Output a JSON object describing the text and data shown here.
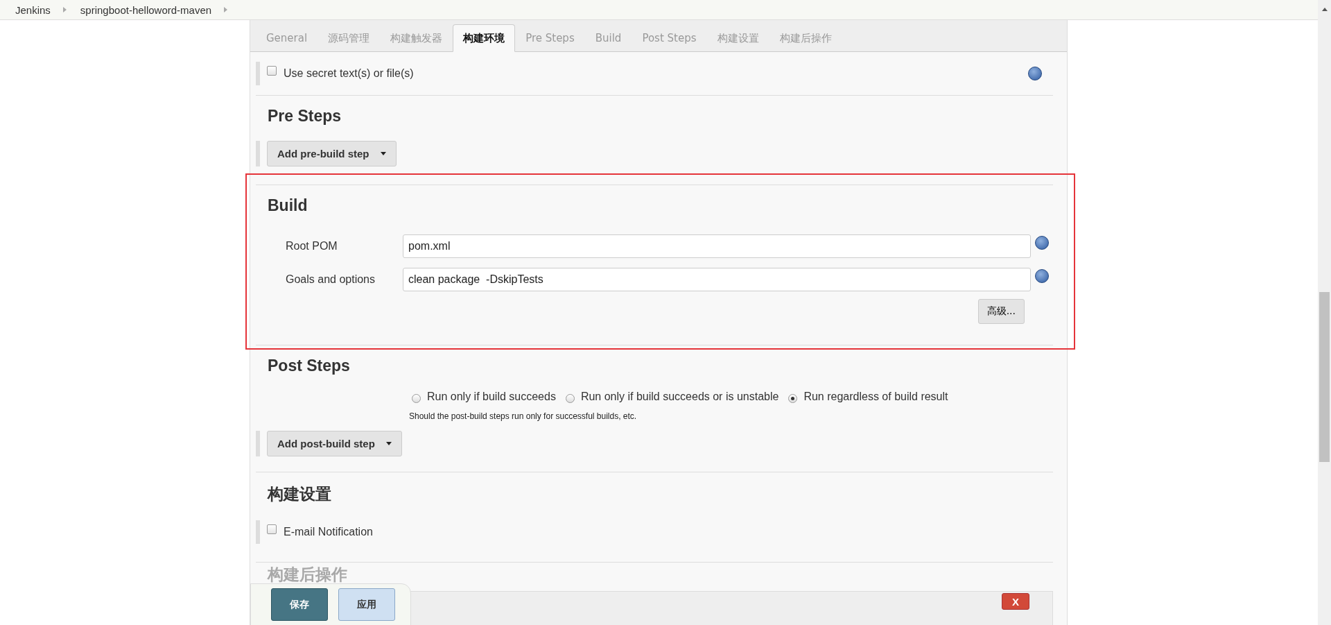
{
  "breadcrumbs": [
    "Jenkins",
    "springboot-helloword-maven"
  ],
  "tabs": [
    {
      "label": "General",
      "selected": false
    },
    {
      "label": "源码管理",
      "selected": false
    },
    {
      "label": "构建触发器",
      "selected": false
    },
    {
      "label": "构建环境",
      "selected": true
    },
    {
      "label": "Pre Steps",
      "selected": false
    },
    {
      "label": "Build",
      "selected": false
    },
    {
      "label": "Post Steps",
      "selected": false
    },
    {
      "label": "构建设置",
      "selected": false
    },
    {
      "label": "构建后操作",
      "selected": false
    }
  ],
  "build_environment": {
    "option": {
      "label": "Use secret text(s) or file(s)",
      "checked": false
    }
  },
  "pre_steps": {
    "title": "Pre Steps",
    "add_button": "Add pre-build step"
  },
  "build": {
    "title": "Build",
    "fields": [
      {
        "label": "Root POM",
        "value": "pom.xml"
      },
      {
        "label": "Goals and options",
        "value": "clean package  -DskipTests"
      }
    ],
    "advanced_button": "高级..."
  },
  "post_steps": {
    "title": "Post Steps",
    "options": [
      {
        "label": "Run only if build succeeds",
        "selected": false
      },
      {
        "label": "Run only if build succeeds or is unstable",
        "selected": false
      },
      {
        "label": "Run regardless of build result",
        "selected": true
      }
    ],
    "hint": "Should the post-build steps run only for successful builds, etc.",
    "add_button": "Add post-build step"
  },
  "build_settings": {
    "title": "构建设置",
    "option": {
      "label": "E-mail Notification",
      "checked": false
    }
  },
  "post_build": {
    "title": "构建后操作",
    "delete_button": "X"
  },
  "footer_buttons": [
    {
      "label": "保存",
      "kind": "primary"
    },
    {
      "label": "应用",
      "kind": "secondary"
    }
  ]
}
